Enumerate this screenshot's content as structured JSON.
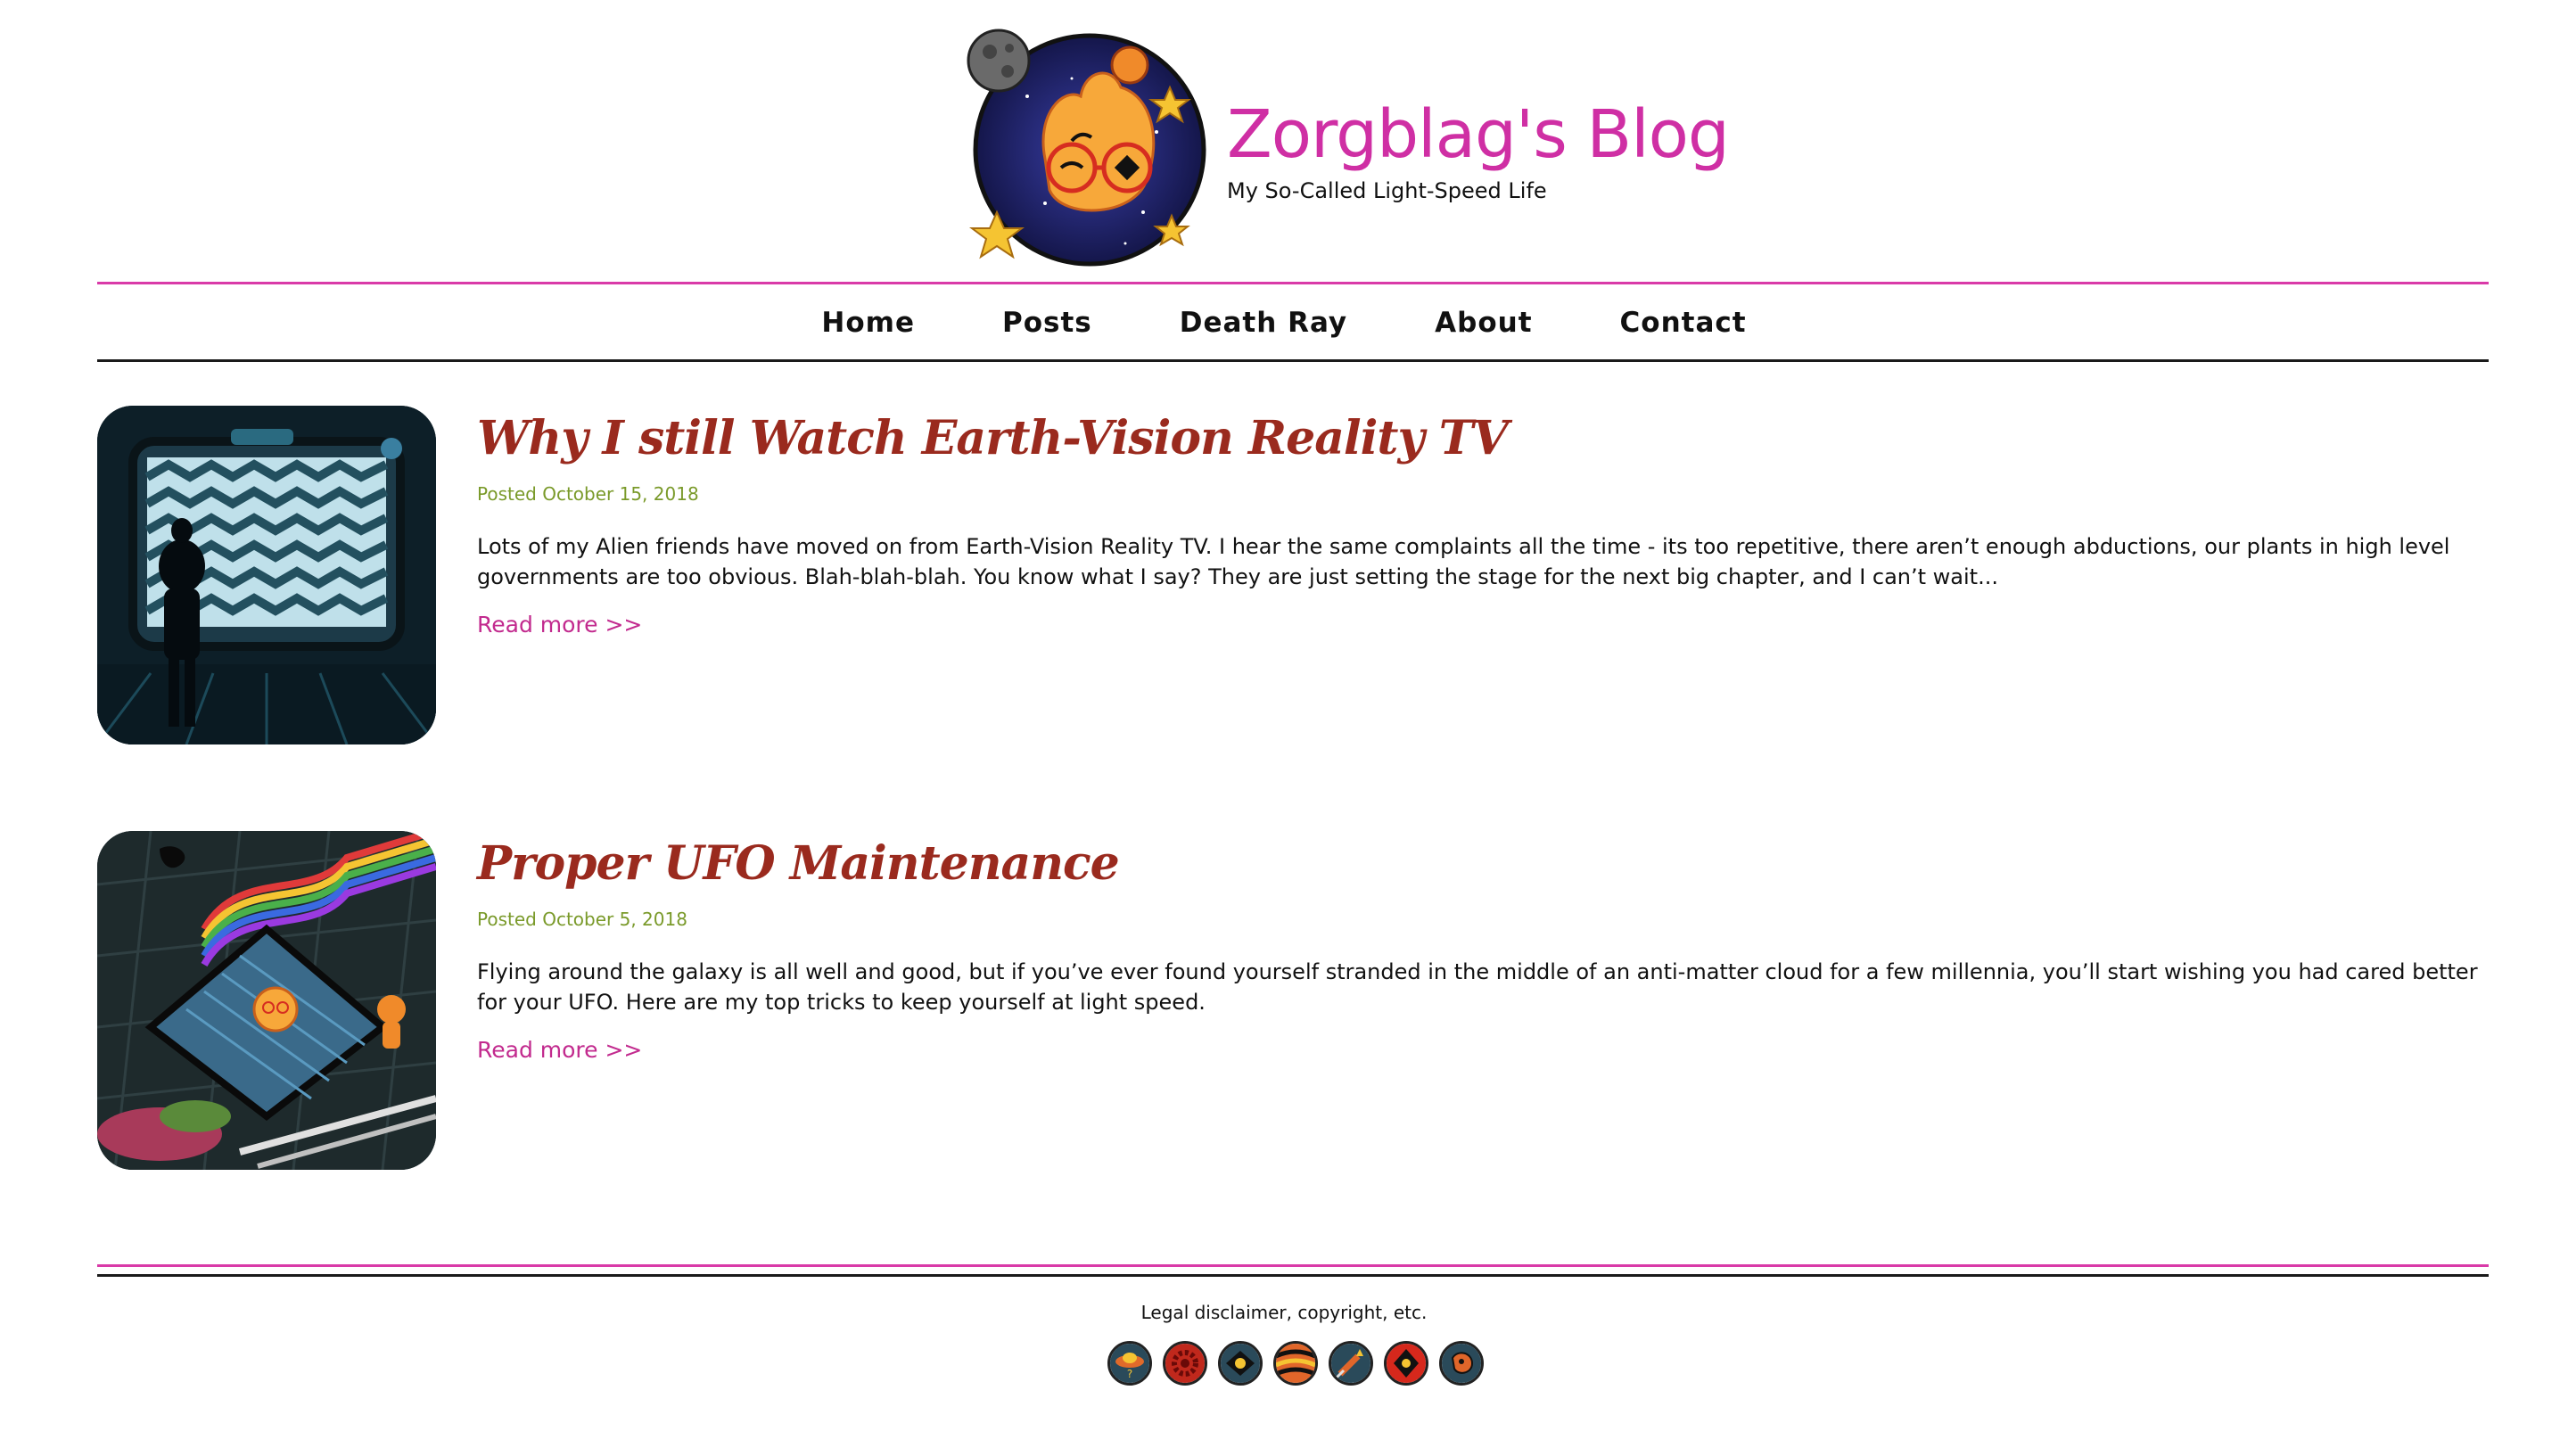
{
  "site": {
    "title": "Zorgblag's Blog",
    "tagline": "My So-Called Light-Speed Life"
  },
  "nav": {
    "items": [
      "Home",
      "Posts",
      "Death Ray",
      "About",
      "Contact"
    ]
  },
  "posts": [
    {
      "title": "Why I still Watch Earth-Vision Reality TV",
      "date": "Posted October 15, 2018",
      "excerpt": "Lots of my Alien friends have moved on from Earth-Vision Reality TV. I hear the same complaints all the time - its too repetitive, there aren’t enough abductions, our plants in high level governments are too obvious. Blah-blah-blah. You know what I say? They are just setting the stage for the next big chapter, and I can’t wait...",
      "read_more": "Read more >>"
    },
    {
      "title": "Proper UFO Maintenance",
      "date": "Posted October 5, 2018",
      "excerpt": "Flying around the galaxy is all well and good, but if you’ve ever found yourself stranded in the middle of an anti-matter cloud for a few millennia, you’ll start wishing you had cared better for your UFO. Here are my top tricks to keep yourself at light speed.",
      "read_more": "Read more >>"
    }
  ],
  "footer": {
    "legal": "Legal disclaimer, copyright, etc.",
    "badges": [
      "ufo-badge-icon",
      "gear-badge-icon",
      "eye-badge-icon",
      "planet-badge-icon",
      "rocket-badge-icon",
      "alien-badge-icon",
      "asteroid-badge-icon"
    ]
  },
  "colors": {
    "title_pink": "#cf2fa4",
    "post_title": "#9a2a1e",
    "date_green": "#7a9a2a",
    "link_pink": "#c22a8e",
    "rule_pink": "#d93aa8"
  }
}
